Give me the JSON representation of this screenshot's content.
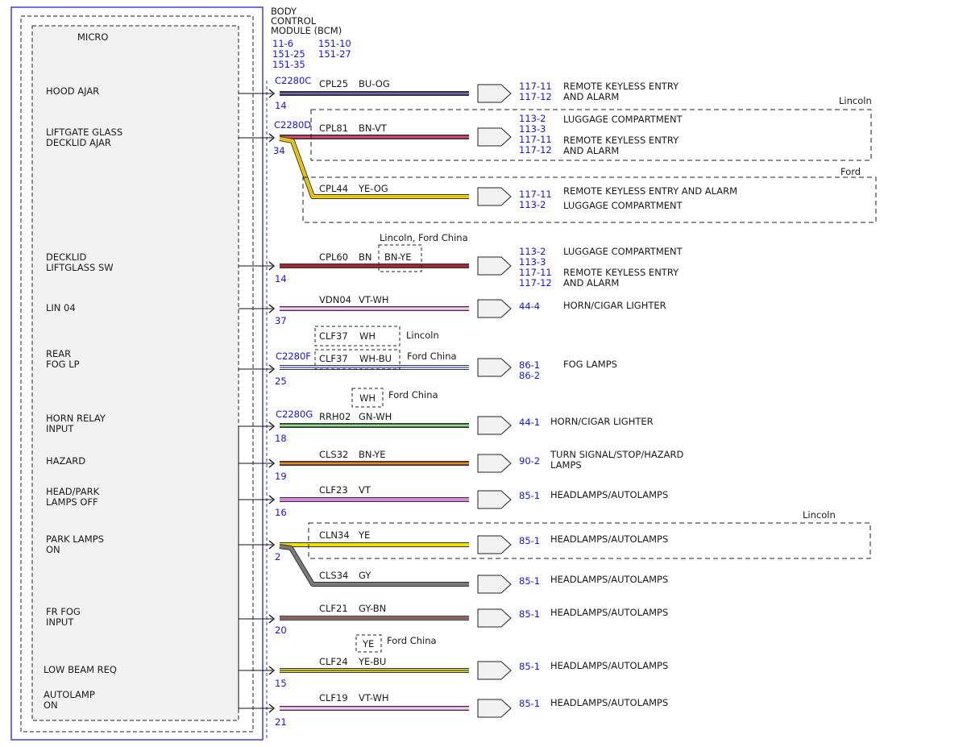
{
  "module": {
    "title_lines": [
      "BODY",
      "CONTROL",
      "MODULE (BCM)"
    ],
    "refs": [
      [
        "11-6",
        "151-10"
      ],
      [
        "151-25",
        "151-27"
      ],
      [
        "151-35",
        ""
      ]
    ],
    "micro_label": "MICRO"
  },
  "inputs": [
    {
      "lines": [
        "HOOD AJAR"
      ]
    },
    {
      "lines": [
        "LIFTGATE GLASS",
        "DECKLID AJAR"
      ]
    },
    {
      "lines": [
        "DECKLID",
        "LIFTGLASS SW"
      ]
    },
    {
      "lines": [
        "LIN 04"
      ]
    },
    {
      "lines": [
        "REAR",
        "FOG LP"
      ]
    },
    {
      "lines": [
        "HORN RELAY",
        "INPUT"
      ]
    },
    {
      "lines": [
        "HAZARD"
      ]
    },
    {
      "lines": [
        "HEAD/PARK",
        "LAMPS OFF"
      ]
    },
    {
      "lines": [
        "PARK LAMPS",
        "ON"
      ]
    },
    {
      "lines": [
        "FR FOG",
        "INPUT"
      ]
    },
    {
      "lines": [
        "LOW BEAM REQ"
      ]
    },
    {
      "lines": [
        "AUTOLAMP",
        "ON"
      ]
    }
  ],
  "connectors": [
    "C2280C",
    "C2280D",
    "C2280F",
    "C2280G"
  ],
  "pins": [
    "14",
    "34",
    "14",
    "37",
    "25",
    "18",
    "19",
    "16",
    "2",
    "20",
    "15",
    "21"
  ],
  "circuits": [
    {
      "id": "CPL25",
      "color": "BU-OG",
      "base": "#1c2fa8",
      "stripe": "#e08a2c",
      "refs": [
        "117-11",
        "117-12"
      ],
      "dest": [
        "REMOTE KEYLESS ENTRY",
        "AND ALARM"
      ]
    },
    {
      "id": "CPL81",
      "color": "BN-VT",
      "base": "#9c2a35",
      "stripe": "#c878c8",
      "refs": [
        "113-2",
        "113-3",
        "117-11",
        "117-12"
      ],
      "dest": [
        "LUGGAGE COMPARTMENT",
        "REMOTE KEYLESS ENTRY",
        "AND ALARM"
      ]
    },
    {
      "id": "CPL44",
      "color": "YE-OG",
      "base": "#f2e200",
      "stripe": "#e89a2c",
      "refs": [
        "117-11",
        "113-2"
      ],
      "dest": [
        "REMOTE KEYLESS ENTRY AND ALARM",
        "LUGGAGE COMPARTMENT"
      ]
    },
    {
      "id": "CPL60",
      "color": "BN",
      "base": "#9c2a35",
      "stripe": "",
      "refs": [
        "113-2",
        "113-3",
        "117-11",
        "117-12"
      ],
      "dest": [
        "LUGGAGE COMPARTMENT",
        "REMOTE KEYLESS ENTRY",
        "AND ALARM"
      ]
    },
    {
      "id": "VDN04",
      "color": "VT-WH",
      "base": "#d989d9",
      "stripe": "#ffffff",
      "refs": [
        "44-4"
      ],
      "dest": [
        "HORN/CIGAR LIGHTER"
      ]
    },
    {
      "id": "CLF37",
      "color": "WH-BU",
      "base": "#ffffff",
      "stripe": "#2a3fd0",
      "refs": [
        "86-1",
        "86-2"
      ],
      "dest": [
        "FOG LAMPS"
      ]
    },
    {
      "id": "RRH02",
      "color": "GN-WH",
      "base": "#2a7a2a",
      "stripe": "#ffffff",
      "refs": [
        "44-1"
      ],
      "dest": [
        "HORN/CIGAR LIGHTER"
      ]
    },
    {
      "id": "CLS32",
      "color": "BN-YE",
      "base": "#9c2a35",
      "stripe": "#f2e200",
      "refs": [
        "90-2"
      ],
      "dest": [
        "TURN SIGNAL/STOP/HAZARD",
        "LAMPS"
      ]
    },
    {
      "id": "CLF23",
      "color": "VT",
      "base": "#d989d9",
      "stripe": "",
      "refs": [
        "85-1"
      ],
      "dest": [
        "HEADLAMPS/AUTOLAMPS"
      ]
    },
    {
      "id": "CLN34",
      "color": "YE",
      "base": "#f2e200",
      "stripe": "",
      "refs": [
        "85-1"
      ],
      "dest": [
        "HEADLAMPS/AUTOLAMPS"
      ]
    },
    {
      "id": "CLS34",
      "color": "GY",
      "base": "#7a7a7a",
      "stripe": "",
      "refs": [
        "85-1"
      ],
      "dest": [
        "HEADLAMPS/AUTOLAMPS"
      ]
    },
    {
      "id": "CLF21",
      "color": "GY-BN",
      "base": "#8a8a8a",
      "stripe": "#9c2a35",
      "refs": [
        "85-1"
      ],
      "dest": [
        "HEADLAMPS/AUTOLAMPS"
      ]
    },
    {
      "id": "CLF24",
      "color": "YE-BU",
      "base": "#f2e200",
      "stripe": "#2a3fd0",
      "refs": [
        "85-1"
      ],
      "dest": [
        "HEADLAMPS/AUTOLAMPS"
      ]
    },
    {
      "id": "CLF19",
      "color": "VT-WH",
      "base": "#d989d9",
      "stripe": "#ffffff",
      "refs": [
        "85-1"
      ],
      "dest": [
        "HEADLAMPS/AUTOLAMPS"
      ]
    }
  ],
  "variants": {
    "lincoln": "Lincoln",
    "ford": "Ford",
    "lincoln_ford_china": "Lincoln, Ford China",
    "ford_china": "Ford China",
    "cpl60_alt_color": "BN-YE",
    "clf37_lincoln_id": "CLF37",
    "clf37_lincoln_color": "WH",
    "rrh02_alt_color": "WH",
    "clf24_alt_color": "YE"
  }
}
